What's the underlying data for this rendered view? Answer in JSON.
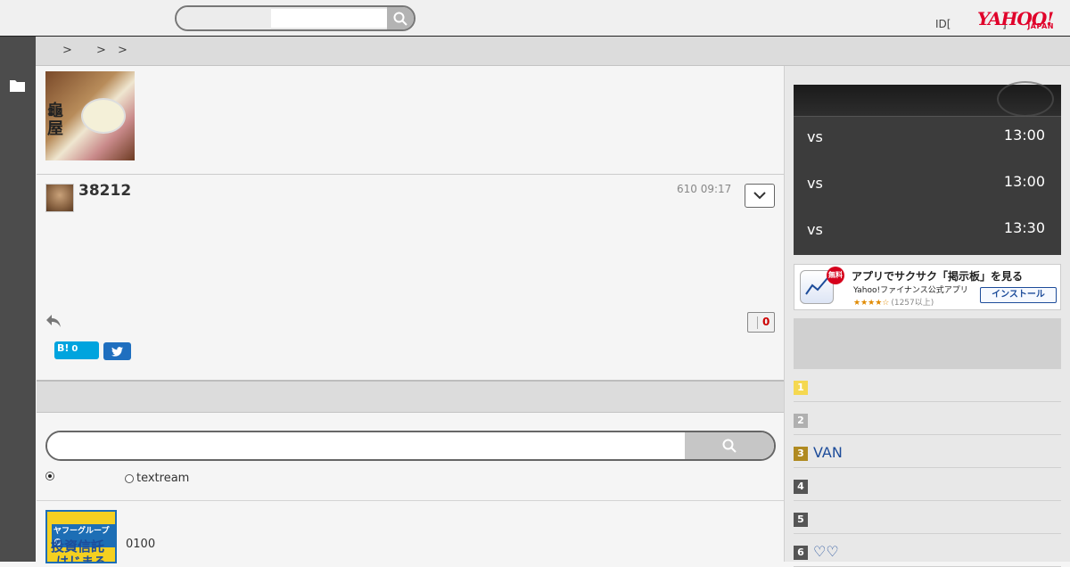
{
  "header": {
    "search_placeholder": "",
    "id_text": "ID[",
    "id_text_end": "]",
    "logo_word": "YAHOO!",
    "logo_sub": "JAPAN"
  },
  "breadcrumb": {
    "sep1": ">",
    "sep2": ">",
    "sep3": ">"
  },
  "post": {
    "number": "38212",
    "date": "610 09:17",
    "like_count": "0",
    "hatena_label": "B!",
    "hatena_count": "0"
  },
  "board_search": {
    "placeholder": "",
    "option2_label": "textream"
  },
  "ad": {
    "img_line1": "ヤフーグループの",
    "img_line2": "投資信託",
    "img_line3": "はじまる",
    "text": "0100"
  },
  "scores": [
    {
      "vs": "vs",
      "time": "13:00"
    },
    {
      "vs": "vs",
      "time": "13:00"
    },
    {
      "vs": "vs",
      "time": "13:30"
    }
  ],
  "app_banner": {
    "badge": "無料",
    "title": "アプリでサクサク「掲示板」を見る",
    "subtitle": "Yahoo!ファイナンス公式アプリ",
    "stars": "★★★★☆",
    "reviews": "(1257以上)",
    "install": "インストール"
  },
  "ranking": [
    {
      "n": "1",
      "name": "",
      "color": "#f5d850"
    },
    {
      "n": "2",
      "name": "",
      "color": "#b0b0b0"
    },
    {
      "n": "3",
      "name": "VAN",
      "color": "#b08a20"
    },
    {
      "n": "4",
      "name": "",
      "color": "#555555"
    },
    {
      "n": "5",
      "name": "",
      "color": "#555555"
    },
    {
      "n": "6",
      "name": "♡♡",
      "color": "#555555"
    }
  ]
}
